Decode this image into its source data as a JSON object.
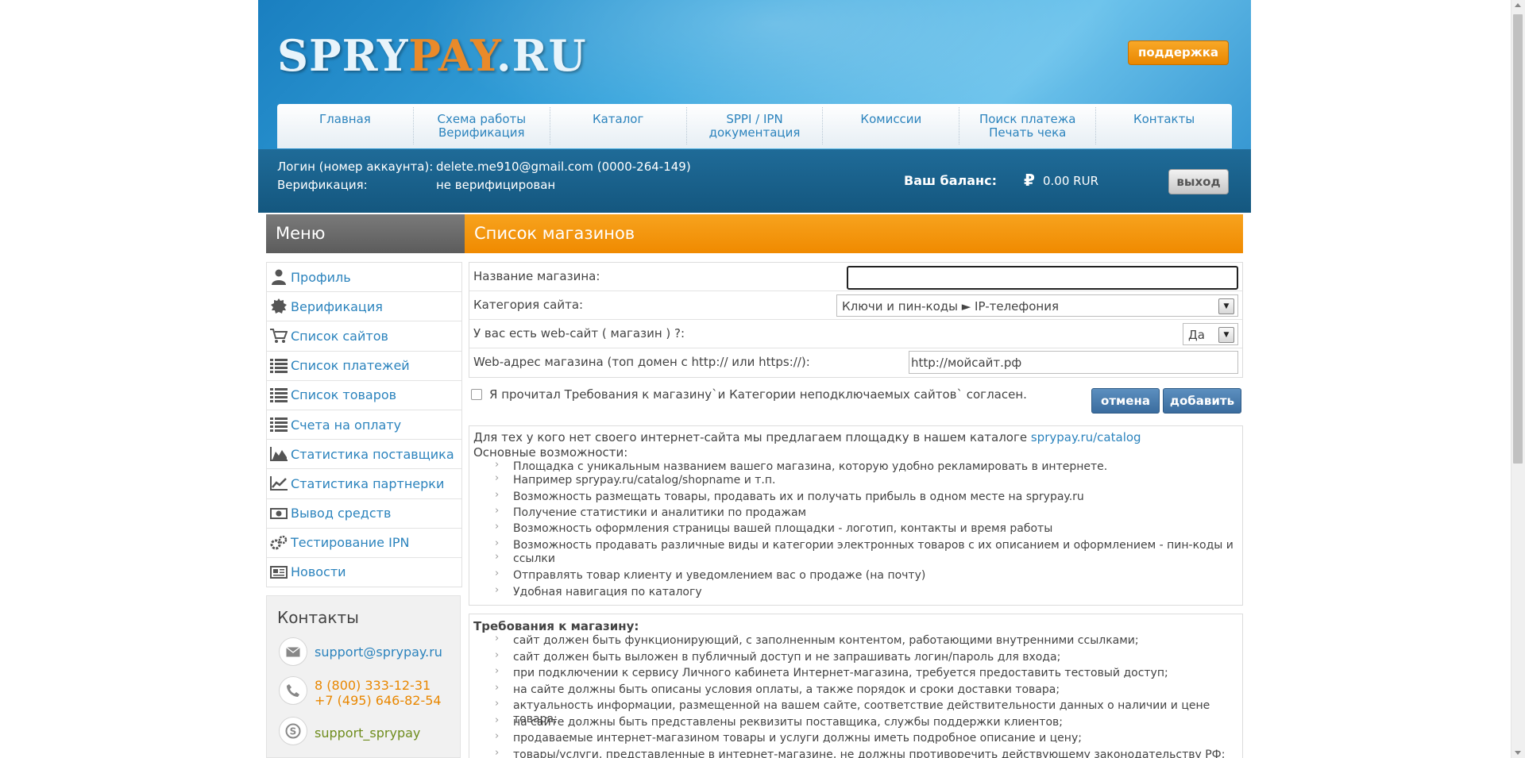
{
  "header": {
    "logo": {
      "part1": "SPRY",
      "part2": "PAY",
      "part3": ".RU"
    },
    "support_button": "поддержка",
    "nav": [
      {
        "line1": "Главная",
        "line2": ""
      },
      {
        "line1": "Схема работы",
        "line2": "Верификация"
      },
      {
        "line1": "Каталог",
        "line2": ""
      },
      {
        "line1": "SPPI / IPN",
        "line2": "документация"
      },
      {
        "line1": "Комиссии",
        "line2": ""
      },
      {
        "line1": "Поиск платежа",
        "line2": "Печать чека"
      },
      {
        "line1": "Контакты",
        "line2": ""
      }
    ]
  },
  "account": {
    "login_label": "Логин (номер аккаунта):",
    "login_value": "delete.me910@gmail.com (0000-264-149)",
    "verification_label": "Верификация:",
    "verification_value": "не верифицирован",
    "balance_label": "Ваш баланс:",
    "balance_value": "0.00  RUR",
    "exit_button": "выход"
  },
  "menu": {
    "title": "Меню",
    "items": [
      {
        "label": "Профиль",
        "icon": "user-icon"
      },
      {
        "label": "Верификация",
        "icon": "verification-seal-icon"
      },
      {
        "label": "Список сайтов",
        "icon": "cart-icon"
      },
      {
        "label": "Список платежей",
        "icon": "list-icon"
      },
      {
        "label": "Список товаров",
        "icon": "list-icon"
      },
      {
        "label": "Счета на оплату",
        "icon": "list-icon"
      },
      {
        "label": "Статистика поставщика",
        "icon": "area-chart-icon"
      },
      {
        "label": "Статистика партнерки",
        "icon": "line-chart-icon"
      },
      {
        "label": "Вывод средств",
        "icon": "banknote-icon"
      },
      {
        "label": "Тестирование IPN",
        "icon": "gears-icon"
      },
      {
        "label": "Новости",
        "icon": "newspaper-icon"
      }
    ]
  },
  "contacts": {
    "title": "Контакты",
    "email": "support@sprypay.ru",
    "phone1": "8 (800) 333-12-31",
    "phone2": "+7 (495) 646-82-54",
    "skype": "support_sprypay"
  },
  "main": {
    "title": "Список магазинов",
    "form": {
      "name_label": "Название магазина:",
      "name_value": "",
      "category_label": "Категория сайта:",
      "category_value": "Ключи и пин-коды ► IP-телефония",
      "has_site_label": "У вас есть web-сайт ( магазин ) ?:",
      "has_site_value": "Да",
      "url_label": "Web-адрес магазина (топ домен с http:// или https://):",
      "url_value": "http://мойсайт.рф"
    },
    "agree_text": "Я прочитал Требования к магазину`и Категории неподключаемых сайтов` согласен.",
    "cancel_button": "отмена",
    "add_button": "добавить",
    "info": {
      "intro": "Для тех у кого нет своего интернет-сайта мы предлагаем площадку в нашем каталоге ",
      "catalog_link": "sprypay.ru/catalog",
      "features_title": "Основные возможности:",
      "features": [
        "Площадка с уникальным названием вашего магазина, которую удобно рекламировать в интернете.",
        "Например sprypay.ru/catalog/shopname и т.п.",
        "Возможность размещать товары, продавать их и получать прибыль в одном месте на sprypay.ru",
        "Получение статистики и аналитики по продажам",
        "Возможность оформления страницы вашей площадки - логотип, контакты и время работы",
        "Возможность продавать различные виды и категории электронных товаров с их описанием и оформлением - пин-коды и",
        "ссылки",
        "Отправлять товар клиенту и уведомлением вас о продаже (на почту)",
        "Удобная навигация по каталогу"
      ]
    },
    "requirements": {
      "title": "Требования к магазину:",
      "items": [
        "сайт должен быть функционирующий, с заполненным контентом, работающими внутренними ссылками;",
        "сайт должен быть выложен в публичный доступ и не запрашивать логин/пароль для входа;",
        "при подключении к сервису Личного кабинета Интернет-магазина, требуется предоставить тестовый доступ;",
        "на сайте должны быть описаны условия оплаты, а также порядок и сроки доставки товара;",
        "актуальность информации, размещенной на вашем сайте, соответствие действительности данных о наличии и цене товара;",
        "на сайте должны быть представлены реквизиты поставщика, службы поддержки клиентов;",
        "продаваемые интернет-магазином товары и услуги должны иметь подробное описание и цену;",
        "товары/услуги, представленные в интернет-магазине, не должны противоречить действующему законодательству РФ;"
      ]
    }
  },
  "colors": {
    "accent_orange": "#f08a00",
    "link_blue": "#2b83bd",
    "header_blue": "#1a7fc0"
  }
}
